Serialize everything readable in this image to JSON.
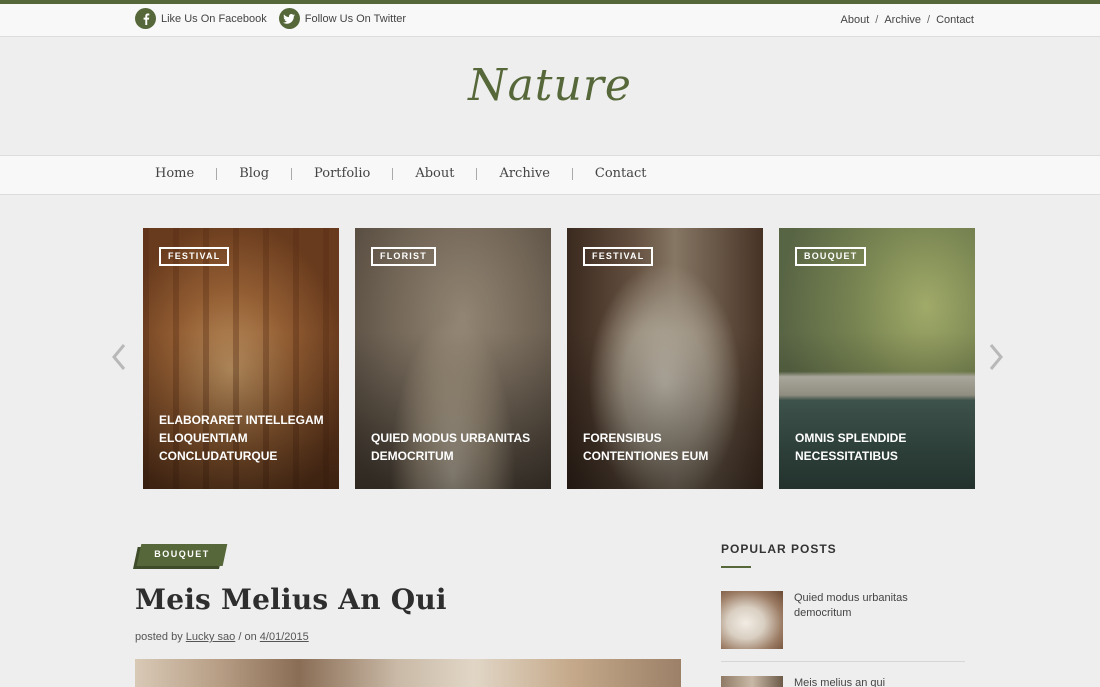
{
  "topbar": {
    "facebook_label": "Like Us On Facebook",
    "twitter_label": "Follow Us On Twitter",
    "links": [
      "About",
      "Archive",
      "Contact"
    ]
  },
  "logo": "Nature",
  "nav": [
    "Home",
    "Blog",
    "Portfolio",
    "About",
    "Archive",
    "Contact"
  ],
  "slides": [
    {
      "tag": "FESTIVAL",
      "title": "ELABORARET INTELLEGAM ELOQUENTIAM CONCLUDATURQUE"
    },
    {
      "tag": "FLORIST",
      "title": "QUIED MODUS URBANITAS DEMOCRITUM"
    },
    {
      "tag": "FESTIVAL",
      "title": "FORENSIBUS CONTENTIONES EUM"
    },
    {
      "tag": "BOUQUET",
      "title": "OMNIS SPLENDIDE NECESSITATIBUS"
    }
  ],
  "post": {
    "category": "BOUQUET",
    "title": "Meis Melius An Qui",
    "meta_prefix": "posted by",
    "author": "Lucky sao",
    "meta_on": "/ on",
    "date": "4/01/2015"
  },
  "sidebar": {
    "heading": "POPULAR POSTS",
    "items": [
      {
        "title": "Quied modus urbanitas democritum"
      },
      {
        "title": "Meis melius an qui"
      }
    ]
  },
  "colors": {
    "accent": "#56683a",
    "background": "#efeeee",
    "bar": "#f8f8f8"
  }
}
